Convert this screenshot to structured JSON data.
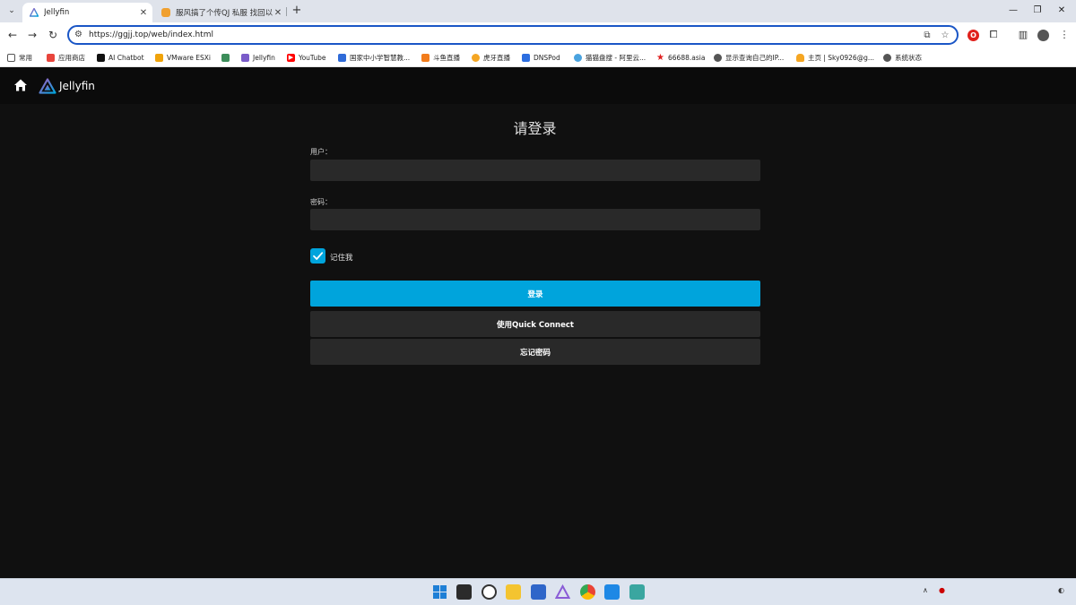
{
  "browser": {
    "tabs": [
      {
        "title": "Jellyfin",
        "active": true
      },
      {
        "title": "服风搞了个传QJ 私服 找回以前...",
        "active": false
      }
    ],
    "url": "https://ggjj.top/web/index.html",
    "bookmarks": [
      {
        "label": "常用",
        "icon": "folder-icon",
        "color": "#555555"
      },
      {
        "label": "应用商店",
        "icon": "store-icon",
        "color": "#e8453c"
      },
      {
        "label": "AI Chatbot",
        "icon": "chatbot-icon",
        "color": "#111111"
      },
      {
        "label": "VMware ESXi",
        "icon": "vmware-icon",
        "color": "#f0a30a"
      },
      {
        "label": "",
        "icon": "generic-app-icon",
        "color": "#3c8d5a"
      },
      {
        "label": "Jellyfin",
        "icon": "jellyfin-icon",
        "color": "#7a5cc9"
      },
      {
        "label": "YouTube",
        "icon": "youtube-icon",
        "color": "#ff0000"
      },
      {
        "label": "国家中小学智慧教...",
        "icon": "education-icon",
        "color": "#2f6bd8"
      },
      {
        "label": "斗鱼直播",
        "icon": "douyu-icon",
        "color": "#f27c1b"
      },
      {
        "label": "虎牙直播",
        "icon": "huya-icon",
        "color": "#f5a623"
      },
      {
        "label": "DNSPod",
        "icon": "dnspod-icon",
        "color": "#2c6ee0"
      },
      {
        "label": "猫猫盘搜 - 阿里云...",
        "icon": "search-engine-icon",
        "color": "#4aa3df"
      },
      {
        "label": "66688.asia",
        "icon": "star-icon",
        "color": "#e02020"
      },
      {
        "label": "显示查询自己的IP...",
        "icon": "globe-icon",
        "color": "#555555"
      },
      {
        "label": "主页 | Sky0926@g...",
        "icon": "cloud-icon",
        "color": "#f5a623"
      },
      {
        "label": "系统状态",
        "icon": "globe-icon",
        "color": "#555555"
      }
    ]
  },
  "app": {
    "name": "Jellyfin"
  },
  "login": {
    "title": "请登录",
    "user_label": "用户：",
    "user_value": "",
    "password_label": "密码：",
    "password_value": "",
    "remember_label": "记住我",
    "remember_checked": true,
    "sign_in_label": "登录",
    "quick_connect_label": "使用Quick Connect",
    "forgot_password_label": "忘记密码"
  },
  "taskbar": {
    "apps": [
      "start-icon",
      "task-view-icon",
      "dell-icon",
      "file-explorer-icon",
      "store-icon",
      "jellyfin-icon",
      "chrome-icon",
      "media-player-icon",
      "network-app-icon"
    ]
  },
  "colors": {
    "accent": "#00a4dc",
    "page_bg": "#101010",
    "field_bg": "#292929",
    "header_bg": "#0b0b0b"
  }
}
